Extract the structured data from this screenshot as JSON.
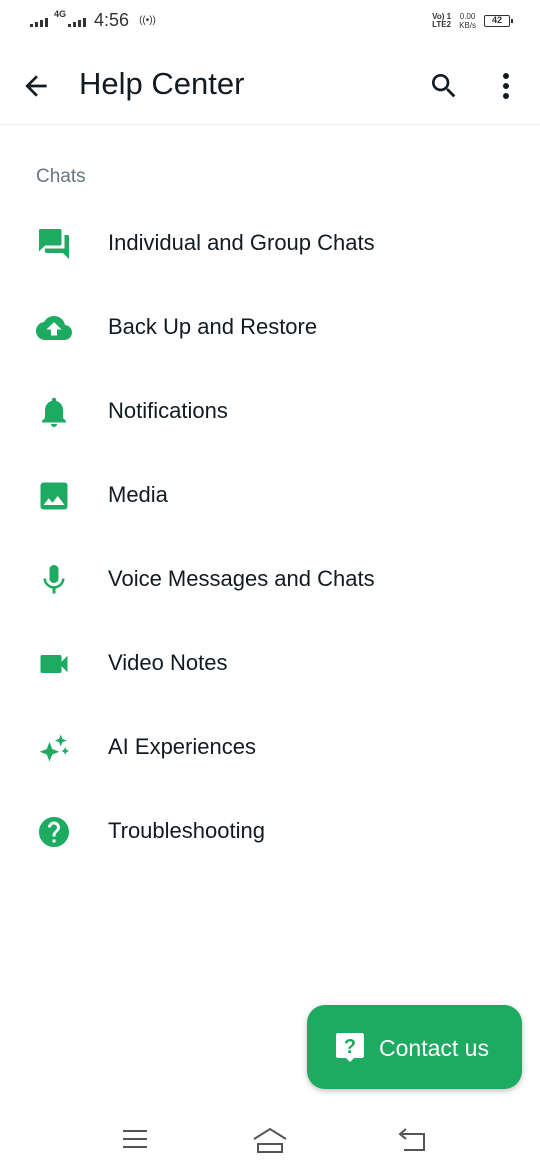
{
  "status_bar": {
    "network": "4G",
    "time": "4:56",
    "hotspot": "((•))",
    "volte_line1": "Vo) 1",
    "volte_line2": "LTE2",
    "speed_value": "0.00",
    "speed_unit": "KB/s",
    "battery": "42"
  },
  "app_bar": {
    "title": "Help Center",
    "icons": [
      "arrow-back-icon",
      "search-icon",
      "more-vert-icon"
    ]
  },
  "section": {
    "label": "Chats"
  },
  "items": [
    {
      "label": "Individual and Group Chats",
      "icon": "chat-bubbles-icon"
    },
    {
      "label": "Back Up and Restore",
      "icon": "cloud-upload-icon"
    },
    {
      "label": "Notifications",
      "icon": "bell-icon"
    },
    {
      "label": "Media",
      "icon": "image-icon"
    },
    {
      "label": "Voice Messages and Chats",
      "icon": "microphone-icon"
    },
    {
      "label": "Video Notes",
      "icon": "videocam-icon"
    },
    {
      "label": "AI Experiences",
      "icon": "sparkles-icon"
    },
    {
      "label": "Troubleshooting",
      "icon": "help-circle-icon"
    }
  ],
  "fab": {
    "label": "Contact us",
    "icon": "question-bubble-icon"
  },
  "nav_bar": {
    "icons": [
      "menu-icon",
      "home-icon",
      "back-icon"
    ]
  },
  "colors": {
    "accent": "#1daa61",
    "text": "#111b21",
    "secondary_text": "#667781"
  }
}
